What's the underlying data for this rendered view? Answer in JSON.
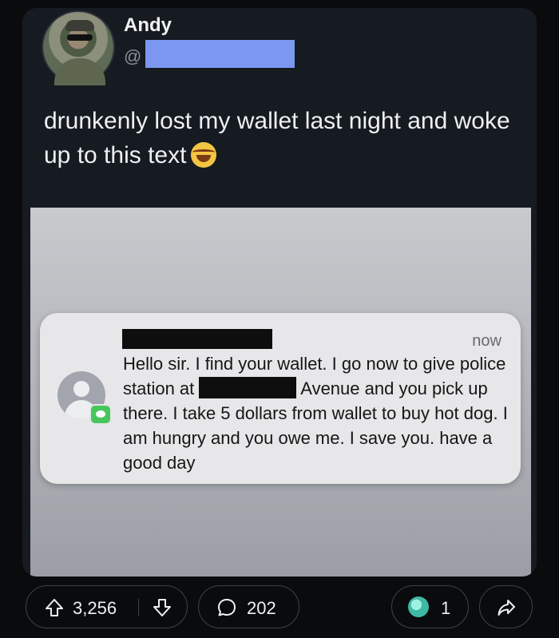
{
  "post": {
    "author": "Andy",
    "handle_prefix": "@",
    "text": "drunkenly lost my wallet last night and woke up to this text"
  },
  "notification": {
    "time": "now",
    "body_part1": "Hello sir. I find your wallet. I go now to give police station at ",
    "body_part2": " Avenue and you pick up there. I take 5 dollars from wallet to buy hot dog. I am hungry and you owe me. I save you. have a good day"
  },
  "actions": {
    "upvotes": "3,256",
    "comments": "202",
    "awards": "1"
  },
  "colors": {
    "background": "#0a0b0d",
    "card": "#161a21",
    "handle_redaction": "#7b97f0",
    "notification": "#e7e6e8"
  },
  "icons": [
    "upvote-icon",
    "downvote-icon",
    "comment-icon",
    "award-icon",
    "share-icon",
    "laughing-emoji-icon",
    "contact-icon",
    "messages-icon"
  ]
}
